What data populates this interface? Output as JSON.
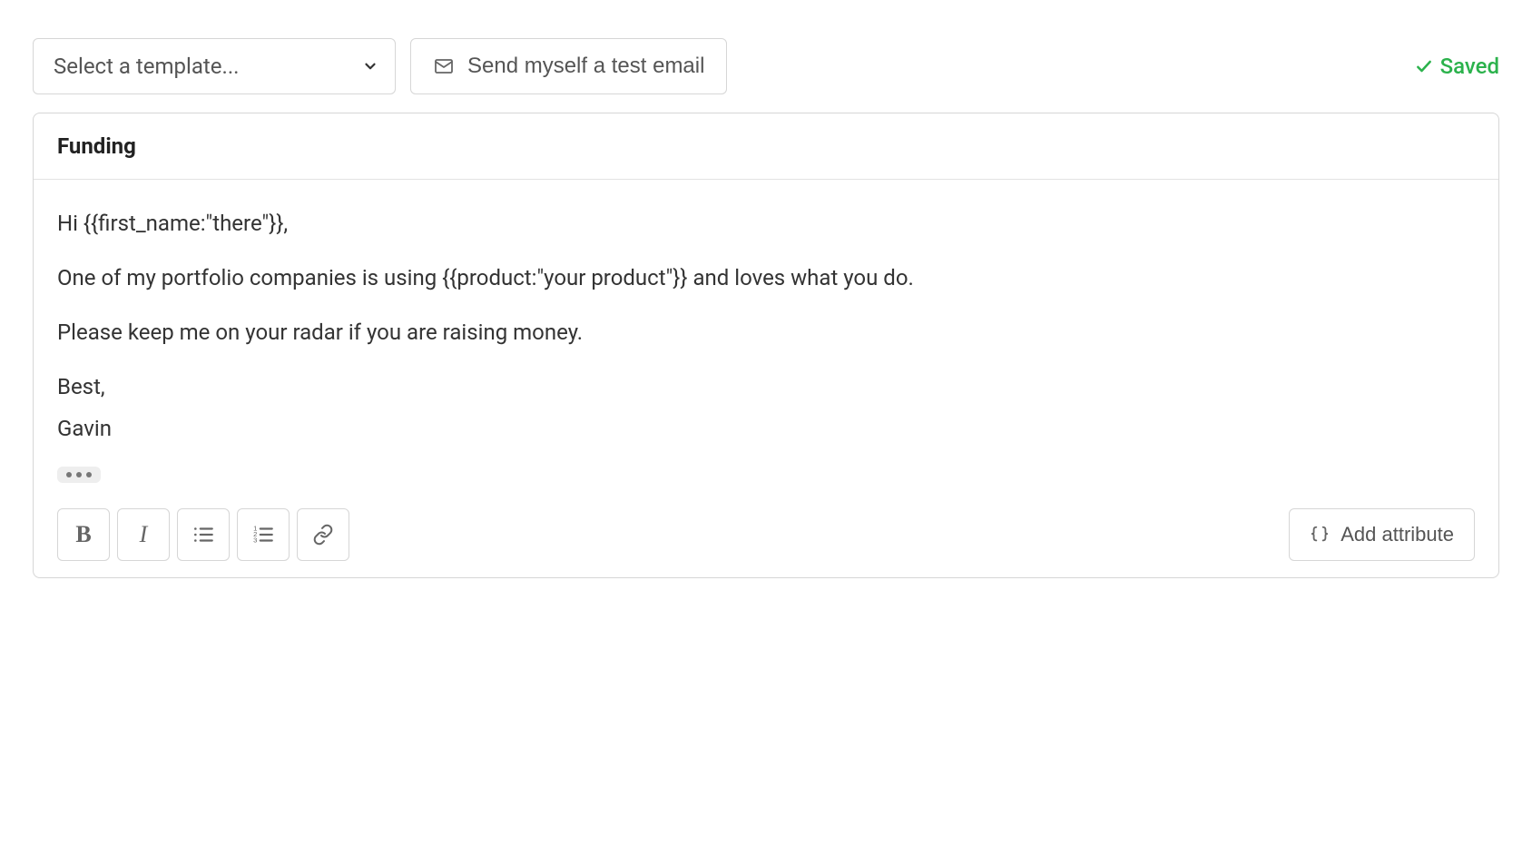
{
  "toolbar": {
    "template_placeholder": "Select a template...",
    "test_email_label": "Send myself a test email",
    "saved_label": "Saved"
  },
  "editor": {
    "subject": "Funding",
    "body": {
      "greeting": "Hi {{first_name:\"there\"}},",
      "line1": "One of my portfolio companies is using {{product:\"your product\"}} and loves what you do.",
      "line2": "Please keep me on your radar if you are raising money.",
      "signoff": "Best,",
      "name": "Gavin"
    },
    "format": {
      "bold_glyph": "B",
      "italic_glyph": "I"
    },
    "add_attribute_label": "Add attribute"
  }
}
